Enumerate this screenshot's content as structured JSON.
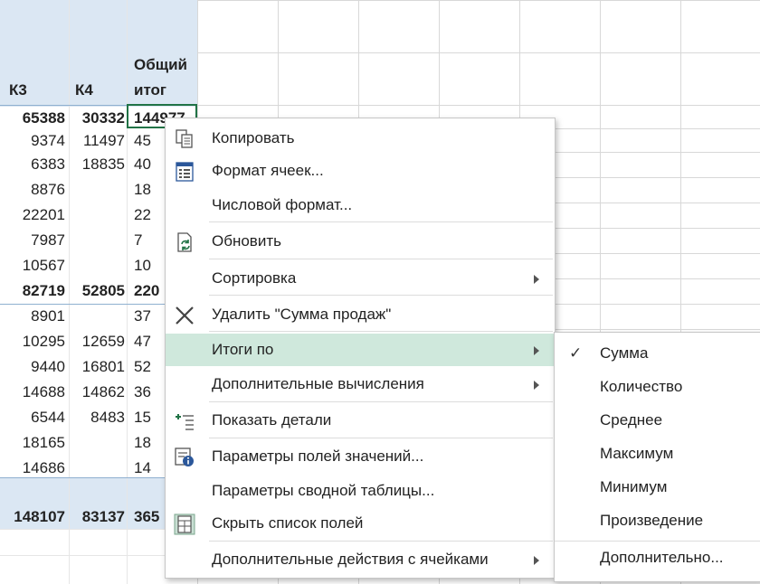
{
  "pivot": {
    "headers": {
      "k3": "К3",
      "k4": "К4",
      "total_line1": "Общий",
      "total_line2": "итог"
    },
    "rows": [
      {
        "k3": "65388",
        "k4": "30332",
        "total": "144977",
        "bold": true
      },
      {
        "k3": "9374",
        "k4": "11497",
        "total": "45",
        "bold": false
      },
      {
        "k3": "6383",
        "k4": "18835",
        "total": "40",
        "bold": false
      },
      {
        "k3": "8876",
        "k4": "",
        "total": "18",
        "bold": false
      },
      {
        "k3": "22201",
        "k4": "",
        "total": "22",
        "bold": false
      },
      {
        "k3": "7987",
        "k4": "",
        "total": "7",
        "bold": false
      },
      {
        "k3": "10567",
        "k4": "",
        "total": "10",
        "bold": false
      },
      {
        "k3": "82719",
        "k4": "52805",
        "total": "220",
        "bold": true
      },
      {
        "k3": "8901",
        "k4": "",
        "total": "37",
        "bold": false
      },
      {
        "k3": "10295",
        "k4": "12659",
        "total": "47",
        "bold": false
      },
      {
        "k3": "9440",
        "k4": "16801",
        "total": "52",
        "bold": false
      },
      {
        "k3": "14688",
        "k4": "14862",
        "total": "36",
        "bold": false
      },
      {
        "k3": "6544",
        "k4": "8483",
        "total": "15",
        "bold": false
      },
      {
        "k3": "18165",
        "k4": "",
        "total": "18",
        "bold": false
      },
      {
        "k3": "14686",
        "k4": "",
        "total": "14",
        "bold": false
      }
    ],
    "grand_total": {
      "k3": "148107",
      "k4": "83137",
      "total": "365"
    }
  },
  "context_menu": {
    "copy": "Копировать",
    "format_cells": "Формат ячеек...",
    "number_format": "Числовой формат...",
    "refresh": "Обновить",
    "sort": "Сортировка",
    "remove_field": "Удалить \"Сумма продаж\"",
    "summarize_by": "Итоги по",
    "show_values_as": "Дополнительные вычисления",
    "show_details": "Показать детали",
    "value_field_settings": "Параметры полей значений...",
    "pivot_options": "Параметры сводной таблицы...",
    "hide_field_list": "Скрыть список полей",
    "more_actions": "Дополнительные действия с ячейками"
  },
  "submenu": {
    "check_mark": "✓",
    "sum": "Сумма",
    "count": "Количество",
    "average": "Среднее",
    "max": "Максимум",
    "min": "Минимум",
    "product": "Произведение",
    "more": "Дополнительно..."
  },
  "colors": {
    "pivot_header_bg": "#dbe7f3",
    "highlight": "#cfe8dc",
    "selection_border": "#217346",
    "excel_green": "#217346",
    "icon_blue": "#2b579a"
  }
}
